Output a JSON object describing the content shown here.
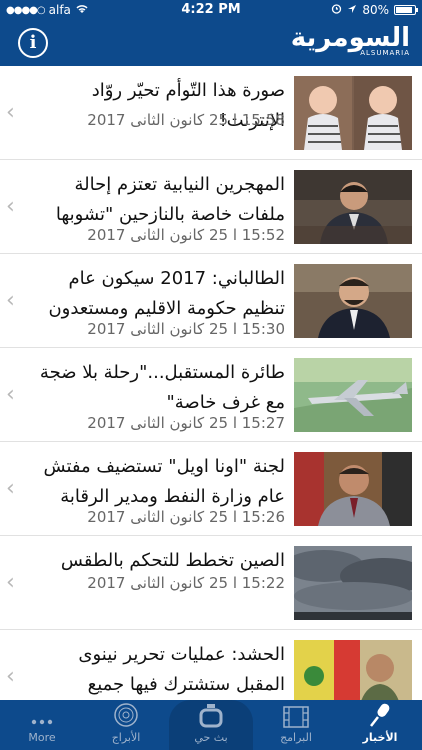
{
  "status": {
    "carrier": "alfa",
    "time": "4:22 PM",
    "battery": "80%"
  },
  "header": {
    "logo_ar": "السومرية",
    "logo_en": "ALSUMARIA",
    "info_label": "i"
  },
  "items": [
    {
      "title": "صورة هذا التّوأم تحيّر روّاد الإنترنت!",
      "date": "15:58 ا 25 كانون الثانى 2017"
    },
    {
      "title": "المهجرين النيابية تعتزم إحالة ملفات خاصة بالنازحين \"تشوبها ش...",
      "date": "15:52 ا 25 كانون الثانى 2017"
    },
    {
      "title": "الطالباني: 2017 سيكون عام تنظيم حكومة الاقليم ومستعدون للتباد...",
      "date": "15:30 ا 25 كانون الثانى 2017"
    },
    {
      "title": "طائرة المستقبل...\"رحلة بلا ضجة مع غرف خاصة\"",
      "date": "15:27 ا 25 كانون الثانى 2017"
    },
    {
      "title": "لجنة \"اونا اويل\" تستضيف مفتش عام وزارة النفط ومدير الرقابة الدا...",
      "date": "15:26 ا 25 كانون الثانى 2017"
    },
    {
      "title": "الصين تخطط للتحكم بالطقس",
      "date": "15:22 ا 25 كانون الثانى 2017"
    },
    {
      "title": "الحشد: عمليات تحرير نينوى المقبل ستشترك فيها جميع القطعات الت...",
      "date": ""
    }
  ],
  "tabs": [
    {
      "label": "More",
      "icon": "more-icon"
    },
    {
      "label": "الأبراج",
      "icon": "horoscope-icon"
    },
    {
      "label": "بث حي",
      "icon": "live-tv-icon"
    },
    {
      "label": "البرامج",
      "icon": "film-icon"
    },
    {
      "label": "الأخبار",
      "icon": "microphone-icon"
    }
  ],
  "colors": {
    "brand": "#0d4a8c",
    "tab_inactive": "#9fb3cc"
  }
}
